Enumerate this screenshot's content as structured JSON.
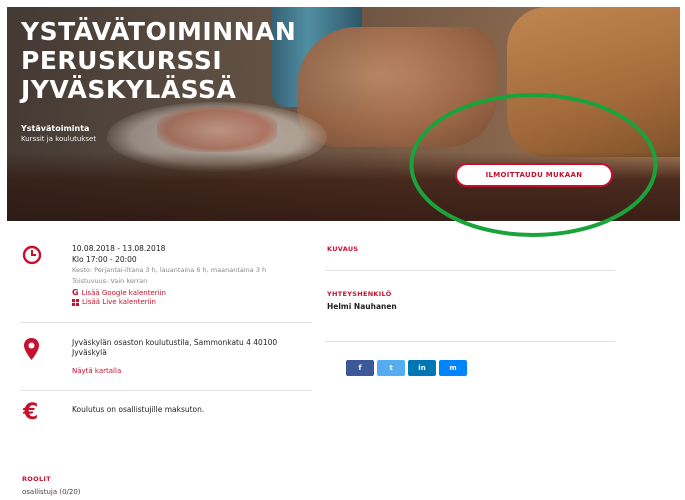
{
  "hero": {
    "title_lines": [
      "YSTÄVÄTOIMINNAN",
      "PERUSKURSSI",
      "JYVÄSKYLÄSSÄ"
    ],
    "organizer": "Ystävätoiminta",
    "category": "Kurssit ja koulutukset",
    "signup_label": "ILMOITTAUDU MUKAAN"
  },
  "event": {
    "dates": "10.08.2018 - 13.08.2018",
    "time": "Klo 17:00 - 20:00",
    "duration": "Kesto: Perjantai-iltana 3 h, lauantaina 6 h, maanantaina 3 h",
    "recurrence": "Toistuvuus: Vain kerran",
    "google_calendar": "Lisää Google kalenteriin",
    "live_calendar": "Lisää Live kalenteriin",
    "address_line1": "Jyväskylän osaston koulutustila, Sammonkatu 4 40100",
    "address_line2": "Jyväskylä",
    "map_link": "Näytä kartalla",
    "fee_text": "Koulutus on osallistujille maksuton."
  },
  "roles": {
    "heading": "ROOLIT",
    "value": "osallistuja (0/20)"
  },
  "side": {
    "description_heading": "KUVAUS",
    "contact_heading": "YHTEYSHENKILÖ",
    "contact_name": "Helmi Nauhanen"
  },
  "share": {
    "facebook": "f",
    "twitter": "t",
    "linkedin": "in",
    "messenger": "m"
  },
  "colors": {
    "brand_red": "#c8102e",
    "annotation_green": "#1aa33a",
    "facebook": "#3b5998",
    "twitter": "#55acee",
    "linkedin": "#0077b5",
    "messenger": "#0084ff"
  },
  "icons": [
    "clock-icon",
    "google-icon",
    "windows-icon",
    "location-pin-icon",
    "euro-icon"
  ]
}
